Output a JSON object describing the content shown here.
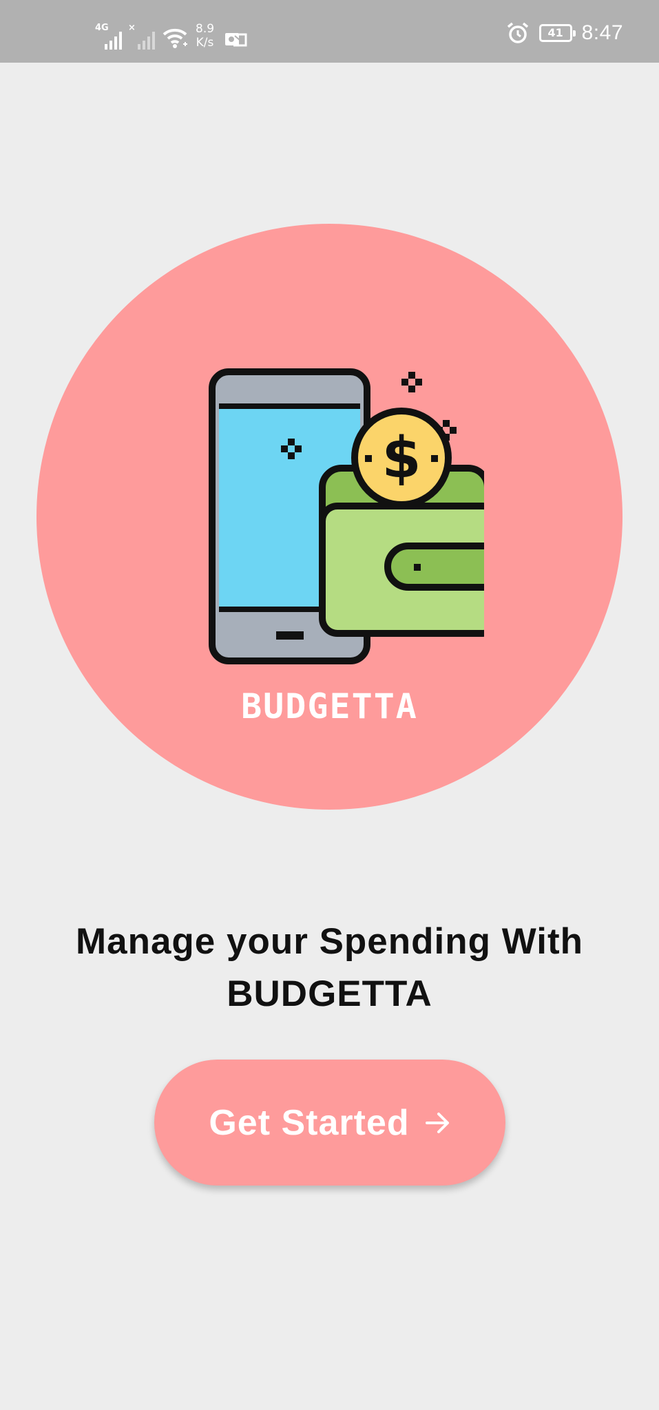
{
  "status_bar": {
    "network_tag_1": "4G",
    "network_tag_2": "×",
    "speed_value": "8.9",
    "speed_unit": "K/s",
    "battery_level": "41",
    "time": "8:47"
  },
  "hero": {
    "brand_text": "BUDGETTA",
    "circle_color": "#fe9b9b"
  },
  "tagline": {
    "line1": "Manage your Spending With",
    "line2": "BUDGETTA"
  },
  "cta": {
    "label": "Get Started",
    "color": "#fe9b9b"
  }
}
